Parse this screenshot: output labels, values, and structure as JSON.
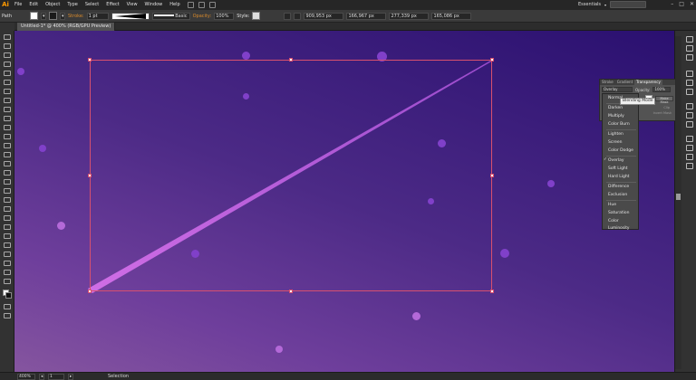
{
  "app": {
    "logo": "Ai",
    "workspace": "Essentials"
  },
  "menu": [
    "File",
    "Edit",
    "Object",
    "Type",
    "Select",
    "Effect",
    "View",
    "Window",
    "Help"
  ],
  "control": {
    "object_type": "Path",
    "stroke_label": "Stroke:",
    "stroke_value": "1 pt",
    "style_label": "Basic",
    "opacity_label": "Opacity:",
    "opacity_value": "100%",
    "style2_label": "Style:",
    "x_value": "909,953 px",
    "y_value": "166,967 px",
    "w_value": "277,339 px",
    "h_value": "165,086 px"
  },
  "document": {
    "tab": "Untitled-1* @ 400% (RGB/GPU Preview)"
  },
  "status": {
    "zoom": "400%",
    "page": "1",
    "tool": "Selection"
  },
  "transparency": {
    "tabs": [
      "Stroke",
      "Gradient",
      "Transparency"
    ],
    "mode": "Overlay",
    "opacity_label": "Opacity:",
    "opacity_value": "100%",
    "make_mask": "Make Mask",
    "clip": "Clip",
    "invert_mask": "Invert Mask"
  },
  "tooltip": "Blending Mode",
  "blend_modes": [
    "Normal",
    "Darken",
    "Multiply",
    "Color Burn",
    "Lighten",
    "Screen",
    "Color Dodge",
    "Overlay",
    "Soft Light",
    "Hard Light",
    "Difference",
    "Exclusion",
    "Hue",
    "Saturation",
    "Color",
    "Luminosity"
  ],
  "blend_selected": "Overlay"
}
